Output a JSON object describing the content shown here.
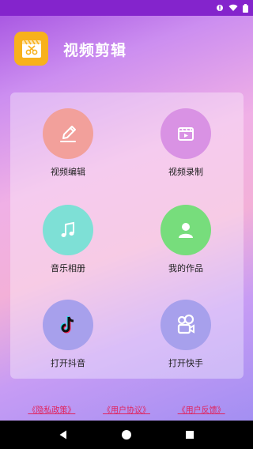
{
  "app": {
    "title": "视频剪辑"
  },
  "colors": {
    "statusbar": "#8424cc",
    "logo": "#f8b11c",
    "link": "#e0245e"
  },
  "tiles": [
    {
      "label": "视频编辑",
      "color": "#f2a09b",
      "icon": "edit-pencil-icon"
    },
    {
      "label": "视频录制",
      "color": "#d992e4",
      "icon": "video-clapper-icon"
    },
    {
      "label": "音乐相册",
      "color": "#7ee0d6",
      "icon": "music-note-icon"
    },
    {
      "label": "我的作品",
      "color": "#77dd7c",
      "icon": "user-profile-icon"
    },
    {
      "label": "打开抖音",
      "color": "#a7a0ec",
      "icon": "tiktok-icon"
    },
    {
      "label": "打开快手",
      "color": "#a7a0ec",
      "icon": "kuaishou-icon"
    }
  ],
  "footer": {
    "privacy": "《隐私政策》",
    "agreement": "《用户协议》",
    "feedback": "《用户反馈》"
  }
}
